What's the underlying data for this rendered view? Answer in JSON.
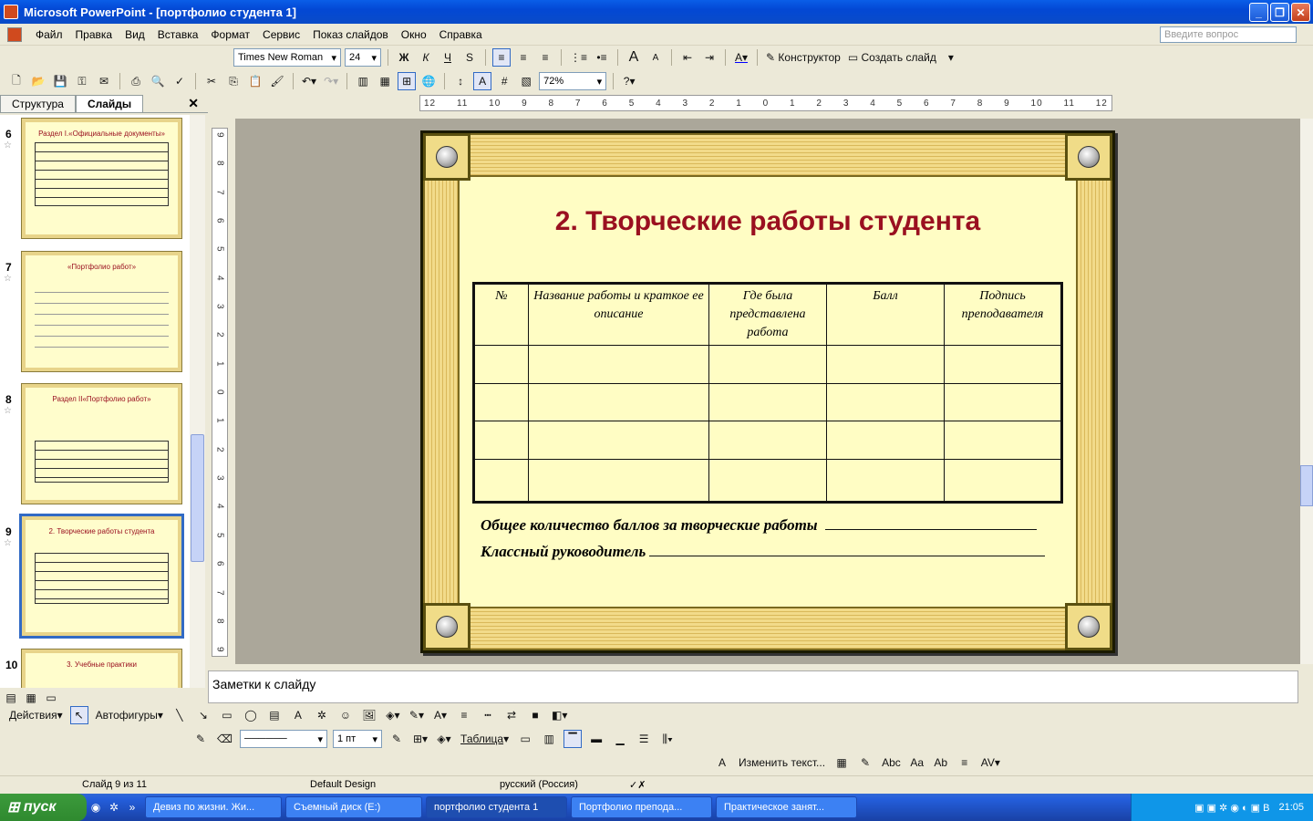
{
  "window": {
    "title": "Microsoft PowerPoint - [портфолио студента 1]"
  },
  "menu": {
    "items": [
      "Файл",
      "Правка",
      "Вид",
      "Вставка",
      "Формат",
      "Сервис",
      "Показ слайдов",
      "Окно",
      "Справка"
    ],
    "ask_placeholder": "Введите вопрос"
  },
  "format_toolbar": {
    "font": "Times New Roman",
    "size": "24",
    "bold": "Ж",
    "italic": "К",
    "underline": "Ч",
    "shadow": "S",
    "designer": "Конструктор",
    "new_slide": "Создать слайд"
  },
  "standard_toolbar": {
    "zoom": "72%"
  },
  "pane": {
    "tabs": [
      "Структура",
      "Слайды"
    ],
    "close": "✕",
    "thumbnails": [
      {
        "num": "6",
        "title": "Раздел I.«Официальные документы»"
      },
      {
        "num": "7",
        "title": "«Портфолио работ»"
      },
      {
        "num": "8",
        "title": "Раздел II«Портфолио работ»"
      },
      {
        "num": "9",
        "title": "2. Творческие работы студента"
      },
      {
        "num": "10",
        "title": "3. Учебные практики"
      }
    ]
  },
  "ruler": {
    "h": [
      "12",
      "11",
      "10",
      "9",
      "8",
      "7",
      "6",
      "5",
      "4",
      "3",
      "2",
      "1",
      "0",
      "1",
      "2",
      "3",
      "4",
      "5",
      "6",
      "7",
      "8",
      "9",
      "10",
      "11",
      "12"
    ],
    "v": [
      "9",
      "8",
      "7",
      "6",
      "5",
      "4",
      "3",
      "2",
      "1",
      "0",
      "1",
      "2",
      "3",
      "4",
      "5",
      "6",
      "7",
      "8",
      "9"
    ]
  },
  "slide": {
    "title": "2. Творческие работы студента",
    "table": {
      "headers": [
        "№",
        "Название работы и краткое ее описание",
        "Где была представлена работа",
        "Балл",
        "Подпись преподавателя"
      ],
      "empty_rows": 4
    },
    "footer_line1": "Общее количество баллов за творческие работы",
    "footer_line2": "Классный руководитель"
  },
  "notes": {
    "placeholder": "Заметки к слайду"
  },
  "drawing": {
    "actions": "Действия",
    "autoshapes": "Автофигуры",
    "line_weight": "1 пт",
    "table": "Таблица",
    "edit_text": "Изменить текст..."
  },
  "status": {
    "slide": "Слайд 9 из 11",
    "design": "Default Design",
    "language": "русский (Россия)"
  },
  "taskbar": {
    "start": "пуск",
    "tasks": [
      {
        "label": "Девиз по жизни. Жи...",
        "active": false
      },
      {
        "label": "Съемный диск (E:)",
        "active": false
      },
      {
        "label": "портфолио студента 1",
        "active": true
      },
      {
        "label": "Портфолио препода...",
        "active": false
      },
      {
        "label": "Практическое занят...",
        "active": false
      }
    ],
    "clock": "21:05"
  },
  "colors": {
    "title_red": "#9a1020",
    "slide_bg": "#fffdc4",
    "border_gold": "#f2db8a"
  }
}
